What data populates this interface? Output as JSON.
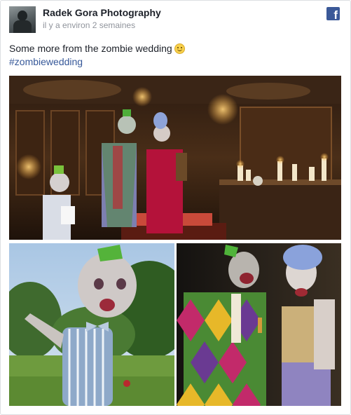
{
  "post": {
    "author": "Radek Gora Photography",
    "timestamp": "il y a environ 2 semaines",
    "text": "Some more from the zombie wedding",
    "emoji": "smiley-face-emoji",
    "hashtag": "#zombiewedding",
    "icon": "facebook-icon"
  },
  "colors": {
    "link": "#365899",
    "meta": "#90949c",
    "facebook_brand": "#3b5998"
  },
  "photos": [
    {
      "name": "photo-zombie-wedding-couple-cutting-cake"
    },
    {
      "name": "photo-zombie-child-blue-striped-outfit"
    },
    {
      "name": "photo-zombie-bride-and-groom"
    }
  ]
}
